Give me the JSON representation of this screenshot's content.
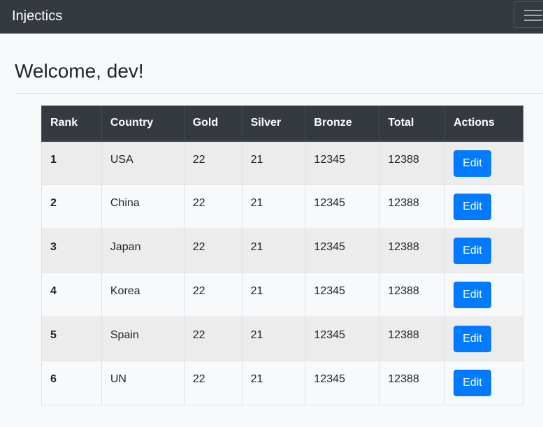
{
  "navbar": {
    "brand": "Injectics",
    "toggler_icon": "hamburger-menu-icon"
  },
  "main": {
    "heading": "Welcome, dev!"
  },
  "table": {
    "headers": [
      "Rank",
      "Country",
      "Gold",
      "Silver",
      "Bronze",
      "Total",
      "Actions"
    ],
    "rows": [
      {
        "rank": "1",
        "country": "USA",
        "gold": "22",
        "silver": "21",
        "bronze": "12345",
        "total": "12388",
        "action": "Edit"
      },
      {
        "rank": "2",
        "country": "China",
        "gold": "22",
        "silver": "21",
        "bronze": "12345",
        "total": "12388",
        "action": "Edit"
      },
      {
        "rank": "3",
        "country": "Japan",
        "gold": "22",
        "silver": "21",
        "bronze": "12345",
        "total": "12388",
        "action": "Edit"
      },
      {
        "rank": "4",
        "country": "Korea",
        "gold": "22",
        "silver": "21",
        "bronze": "12345",
        "total": "12388",
        "action": "Edit"
      },
      {
        "rank": "5",
        "country": "Spain",
        "gold": "22",
        "silver": "21",
        "bronze": "12345",
        "total": "12388",
        "action": "Edit"
      },
      {
        "rank": "6",
        "country": "UN",
        "gold": "22",
        "silver": "21",
        "bronze": "12345",
        "total": "12388",
        "action": "Edit"
      }
    ]
  },
  "colors": {
    "navbar_bg": "#343a40",
    "table_header_bg": "#343a40",
    "button_primary": "#007bff",
    "page_bg": "#f8f9fa",
    "striped_row": "#ececec"
  }
}
